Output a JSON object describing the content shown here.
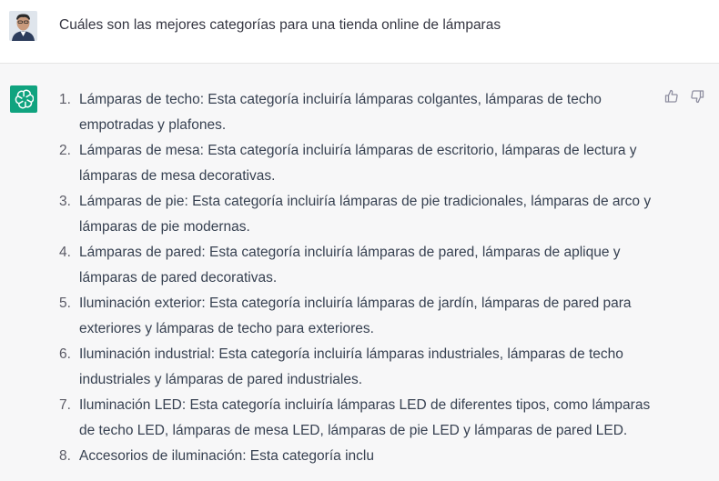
{
  "user_message": {
    "text": "Cuáles son las mejores categorías para una tienda online de lámparas"
  },
  "assistant_message": {
    "items": [
      {
        "number": "1.",
        "text": "Lámparas de techo: Esta categoría incluiría lámparas colgantes, lámparas de techo empotradas y plafones."
      },
      {
        "number": "2.",
        "text": "Lámparas de mesa: Esta categoría incluiría lámparas de escritorio, lámparas de lectura y lámparas de mesa decorativas."
      },
      {
        "number": "3.",
        "text": "Lámparas de pie: Esta categoría incluiría lámparas de pie tradicionales, lámparas de arco y lámparas de pie modernas."
      },
      {
        "number": "4.",
        "text": "Lámparas de pared: Esta categoría incluiría lámparas de pared, lámparas de aplique y lámparas de pared decorativas."
      },
      {
        "number": "5.",
        "text": "Iluminación exterior: Esta categoría incluiría lámparas de jardín, lámparas de pared para exteriores y lámparas de techo para exteriores."
      },
      {
        "number": "6.",
        "text": "Iluminación industrial: Esta categoría incluiría lámparas industriales, lámparas de techo industriales y lámparas de pared industriales."
      },
      {
        "number": "7.",
        "text": "Iluminación LED: Esta categoría incluiría lámparas LED de diferentes tipos, como lámparas de techo LED, lámparas de mesa LED, lámparas de pie LED y lámparas de pared LED."
      },
      {
        "number": "8.",
        "text": "Accesorios de iluminación: Esta categoría inclu"
      }
    ]
  },
  "icons": {
    "avatar": "user-avatar",
    "assistant": "openai-logo-icon",
    "thumbs_up": "thumbs-up-icon",
    "thumbs_down": "thumbs-down-icon"
  },
  "colors": {
    "assistant_bg": "#f7f7f8",
    "logo_bg": "#10a37f",
    "text": "#374151"
  }
}
